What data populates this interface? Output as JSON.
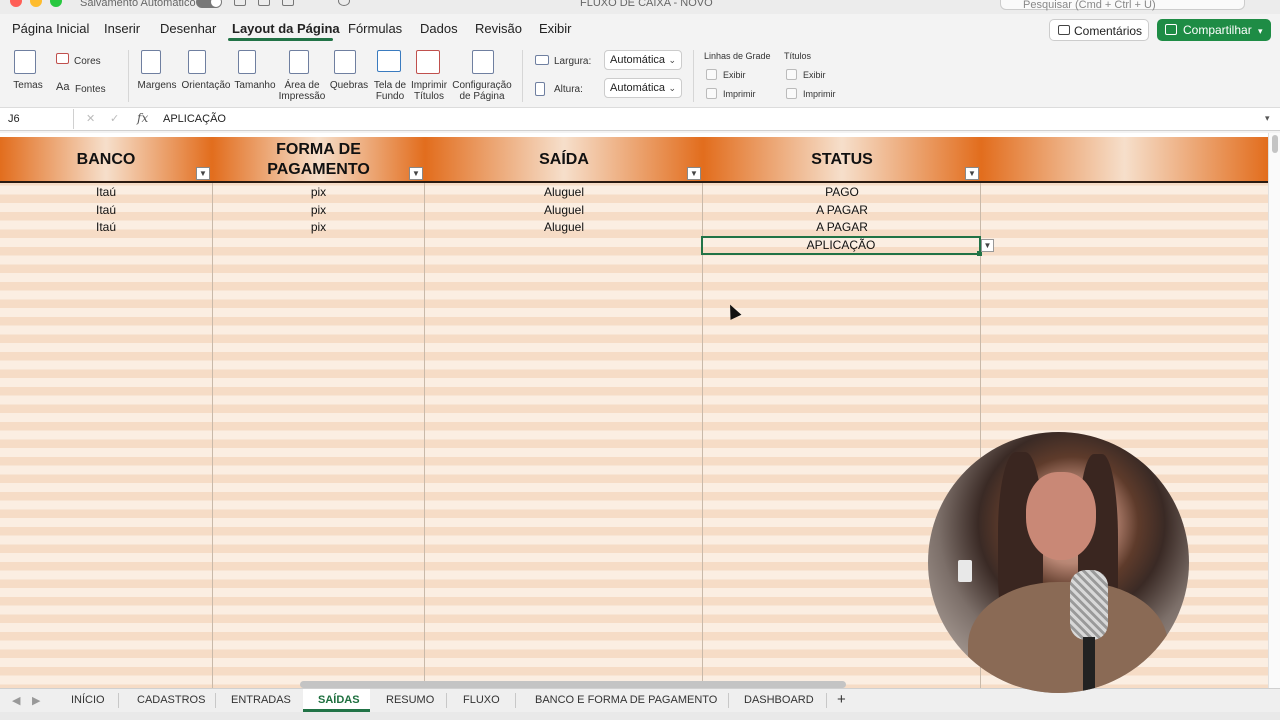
{
  "app": {
    "autosave_label": "Salvamento Automático",
    "doc_title": "FLUXO DE CAIXA - NOVO",
    "search_placeholder": "Pesquisar (Cmd + Ctrl + U)"
  },
  "ribbon_tabs": [
    "Página Inicial",
    "Inserir",
    "Desenhar",
    "Layout da Página",
    "Fórmulas",
    "Dados",
    "Revisão",
    "Exibir"
  ],
  "active_ribbon_tab": "Layout da Página",
  "header_buttons": {
    "comments": "Comentários",
    "share": "Compartilhar"
  },
  "ribbon": {
    "temas": "Temas",
    "cores": "Cores",
    "fontes": "Fontes",
    "margens": "Margens",
    "orientacao": "Orientação",
    "tamanho": "Tamanho",
    "area_line1": "Área de",
    "area_line2": "Impressão",
    "quebras": "Quebras",
    "tela_line1": "Tela de",
    "tela_line2": "Fundo",
    "imprimir_line1": "Imprimir",
    "imprimir_line2": "Títulos",
    "config_line1": "Configuração",
    "config_line2": "de Página",
    "largura_label": "Largura:",
    "largura_value": "Automática",
    "altura_label": "Altura:",
    "altura_value": "Automática",
    "gridlines_title": "Linhas de Grade",
    "titles_title": "Títulos",
    "exibir": "Exibir",
    "imprimir": "Imprimir"
  },
  "formula_bar": {
    "cell_ref": "J6",
    "fx": "fx",
    "content": "APLICAÇÃO"
  },
  "table": {
    "headers": {
      "banco": "BANCO",
      "forma_line1": "FORMA DE",
      "forma_line2": "PAGAMENTO",
      "saida": "SAÍDA",
      "status": "STATUS"
    },
    "rows": [
      {
        "banco": "Itaú",
        "forma": "pix",
        "saida": "Aluguel",
        "status": "PAGO"
      },
      {
        "banco": "Itaú",
        "forma": "pix",
        "saida": "Aluguel",
        "status": "A PAGAR"
      },
      {
        "banco": "Itaú",
        "forma": "pix",
        "saida": "Aluguel",
        "status": "A PAGAR"
      }
    ],
    "selected_cell_value": "APLICAÇÃO"
  },
  "sheet_tabs": [
    "INÍCIO",
    "CADASTROS",
    "ENTRADAS",
    "SAÍDAS",
    "RESUMO",
    "FLUXO",
    "BANCO E FORMA DE PAGAMENTO",
    "DASHBOARD"
  ],
  "active_sheet": "SAÍDAS",
  "add_sheet": "+",
  "colors": {
    "accent": "#217346",
    "header_orange": "#e26d1d",
    "share_green": "#1e8c45"
  },
  "icons": [
    "search-icon",
    "comment-icon",
    "share-icon",
    "filter-dropdown-icon",
    "autosave-toggle"
  ]
}
